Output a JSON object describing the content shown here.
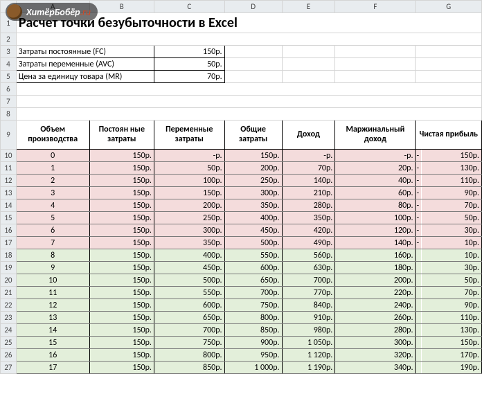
{
  "watermark": {
    "brand_bold": "ХитёрБобёр",
    "brand_tld": ".ru"
  },
  "columns": [
    "A",
    "B",
    "C",
    "D",
    "E",
    "F",
    "G"
  ],
  "title": "Расчет точки безубыточности в Excel",
  "params": [
    {
      "label": "Затраты постоянные (FC)",
      "value": "150р."
    },
    {
      "label": "Затраты переменные (AVC)",
      "value": "50р."
    },
    {
      "label": "Цена за единицу товара (MR)",
      "value": "70р."
    }
  ],
  "table": {
    "headers": [
      "Объем производства",
      "Постоян ные затраты",
      "Переменные затраты",
      "Общие затраты",
      "Доход",
      "Маржинальный доход",
      "Чистая прибыль"
    ],
    "rows": [
      {
        "n": 10,
        "q": "0",
        "fc": "150р.",
        "vc": "-р.",
        "tc": "150р.",
        "rev": "-р.",
        "mp": "-р.",
        "sign": "-",
        "np": "150р.",
        "cls": "pink"
      },
      {
        "n": 11,
        "q": "1",
        "fc": "150р.",
        "vc": "50р.",
        "tc": "200р.",
        "rev": "70р.",
        "mp": "20р.",
        "sign": "-",
        "np": "130р.",
        "cls": "pink"
      },
      {
        "n": 12,
        "q": "2",
        "fc": "150р.",
        "vc": "100р.",
        "tc": "250р.",
        "rev": "140р.",
        "mp": "40р.",
        "sign": "-",
        "np": "110р.",
        "cls": "pink"
      },
      {
        "n": 13,
        "q": "3",
        "fc": "150р.",
        "vc": "150р.",
        "tc": "300р.",
        "rev": "210р.",
        "mp": "60р.",
        "sign": "-",
        "np": "90р.",
        "cls": "pink"
      },
      {
        "n": 14,
        "q": "4",
        "fc": "150р.",
        "vc": "200р.",
        "tc": "350р.",
        "rev": "280р.",
        "mp": "80р.",
        "sign": "-",
        "np": "70р.",
        "cls": "pink"
      },
      {
        "n": 15,
        "q": "5",
        "fc": "150р.",
        "vc": "250р.",
        "tc": "400р.",
        "rev": "350р.",
        "mp": "100р.",
        "sign": "-",
        "np": "50р.",
        "cls": "pink"
      },
      {
        "n": 16,
        "q": "6",
        "fc": "150р.",
        "vc": "300р.",
        "tc": "450р.",
        "rev": "420р.",
        "mp": "120р.",
        "sign": "-",
        "np": "30р.",
        "cls": "pink"
      },
      {
        "n": 17,
        "q": "7",
        "fc": "150р.",
        "vc": "350р.",
        "tc": "500р.",
        "rev": "490р.",
        "mp": "140р.",
        "sign": "-",
        "np": "10р.",
        "cls": "pink"
      },
      {
        "n": 18,
        "q": "8",
        "fc": "150р.",
        "vc": "400р.",
        "tc": "550р.",
        "rev": "560р.",
        "mp": "160р.",
        "sign": "",
        "np": "10р.",
        "cls": "green"
      },
      {
        "n": 19,
        "q": "9",
        "fc": "150р.",
        "vc": "450р.",
        "tc": "600р.",
        "rev": "630р.",
        "mp": "180р.",
        "sign": "",
        "np": "30р.",
        "cls": "green"
      },
      {
        "n": 20,
        "q": "10",
        "fc": "150р.",
        "vc": "500р.",
        "tc": "650р.",
        "rev": "700р.",
        "mp": "200р.",
        "sign": "",
        "np": "50р.",
        "cls": "green"
      },
      {
        "n": 21,
        "q": "11",
        "fc": "150р.",
        "vc": "550р.",
        "tc": "700р.",
        "rev": "770р.",
        "mp": "220р.",
        "sign": "",
        "np": "70р.",
        "cls": "green"
      },
      {
        "n": 22,
        "q": "12",
        "fc": "150р.",
        "vc": "600р.",
        "tc": "750р.",
        "rev": "840р.",
        "mp": "240р.",
        "sign": "",
        "np": "90р.",
        "cls": "green"
      },
      {
        "n": 23,
        "q": "13",
        "fc": "150р.",
        "vc": "650р.",
        "tc": "800р.",
        "rev": "910р.",
        "mp": "260р.",
        "sign": "",
        "np": "110р.",
        "cls": "green"
      },
      {
        "n": 24,
        "q": "14",
        "fc": "150р.",
        "vc": "700р.",
        "tc": "850р.",
        "rev": "980р.",
        "mp": "280р.",
        "sign": "",
        "np": "130р.",
        "cls": "green"
      },
      {
        "n": 25,
        "q": "15",
        "fc": "150р.",
        "vc": "750р.",
        "tc": "900р.",
        "rev": "1 050р.",
        "mp": "300р.",
        "sign": "",
        "np": "150р.",
        "cls": "green"
      },
      {
        "n": 26,
        "q": "16",
        "fc": "150р.",
        "vc": "800р.",
        "tc": "950р.",
        "rev": "1 120р.",
        "mp": "320р.",
        "sign": "",
        "np": "170р.",
        "cls": "green"
      },
      {
        "n": 27,
        "q": "17",
        "fc": "150р.",
        "vc": "850р.",
        "tc": "1 000р.",
        "rev": "1 190р.",
        "mp": "340р.",
        "sign": "",
        "np": "190р.",
        "cls": "green"
      }
    ]
  }
}
